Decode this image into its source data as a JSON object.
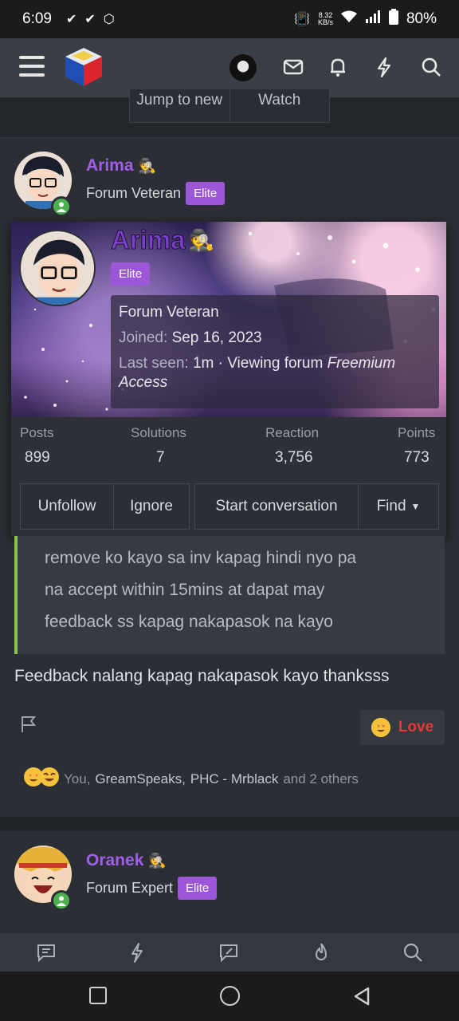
{
  "status_bar": {
    "time": "6:09",
    "net_speed_value": "8.32",
    "net_speed_unit": "KB/s",
    "battery": "80%"
  },
  "jump_bar": {
    "jump_label": "Jump to new",
    "watch_label": "Watch"
  },
  "post1": {
    "author": "Arima",
    "user_title": "Forum Veteran",
    "badge": "Elite"
  },
  "tooltip": {
    "username": "Arima",
    "badge": "Elite",
    "user_title": "Forum Veteran",
    "joined_label": "Joined:",
    "joined_value": "Sep 16, 2023",
    "last_seen_label": "Last seen:",
    "last_seen_value": "1m · Viewing forum",
    "last_seen_forum": "Freemium Access",
    "stats": [
      {
        "label": "Posts",
        "value": "899"
      },
      {
        "label": "Solutions",
        "value": "7"
      },
      {
        "label": "Reaction",
        "value": "3,756"
      },
      {
        "label": "Points",
        "value": "773"
      }
    ],
    "buttons": {
      "unfollow": "Unfollow",
      "ignore": "Ignore",
      "start_conversation": "Start conversation",
      "find": "Find"
    }
  },
  "quote": {
    "line1": "remove ko kayo sa inv kapag hindi nyo pa",
    "line2": "na accept within 15mins at dapat may",
    "line3": "feedback ss kapag nakapasok na kayo"
  },
  "post_body": "Feedback nalang kapag nakapasok kayo thanksss",
  "love_button": "Love",
  "reaction_summary": {
    "you": "You,",
    "user1": "GreamSpeaks,",
    "user2": "PHC - Mrblack",
    "rest": "and 2 others"
  },
  "post2": {
    "author": "Oranek",
    "user_title": "Forum Expert",
    "badge": "Elite"
  },
  "colors": {
    "accent_purple": "#a25ee8",
    "elite_badge": "#9b57d8",
    "quote_border": "#8bc34a",
    "love_red": "#e53935",
    "online_green": "#4caf50"
  },
  "icons": {
    "header": [
      "menu-icon",
      "site-logo",
      "user-avatar",
      "mail-icon",
      "bell-icon",
      "lightning-icon",
      "search-icon"
    ],
    "tabbar": [
      "forums-icon",
      "whats-new-icon",
      "new-post-icon",
      "trending-icon",
      "search-icon"
    ]
  }
}
